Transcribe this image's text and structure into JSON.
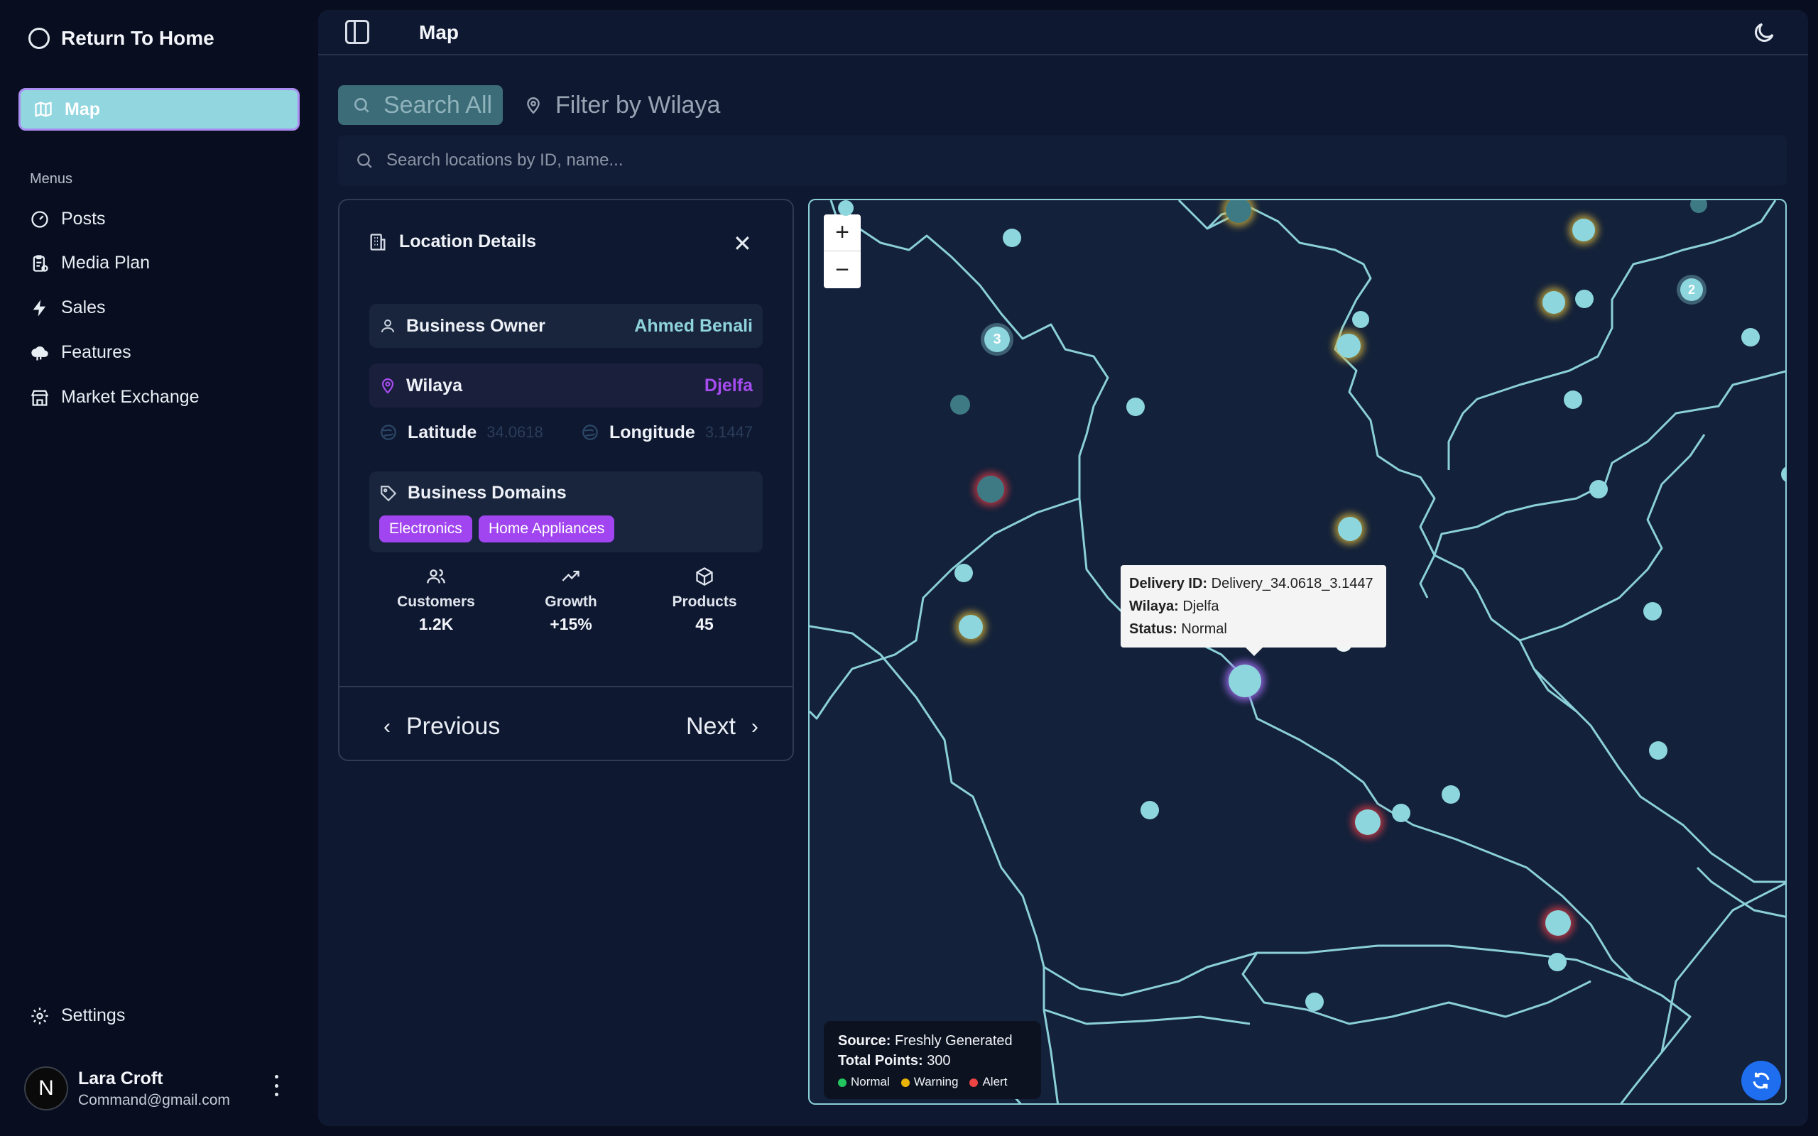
{
  "sidebar": {
    "brand": "Return To Home",
    "active_item": "Map",
    "section_label": "Menus",
    "items": [
      {
        "label": "Posts",
        "icon": "gauge-icon"
      },
      {
        "label": "Media Plan",
        "icon": "clipboard-icon"
      },
      {
        "label": "Sales",
        "icon": "lightning-icon"
      },
      {
        "label": "Features",
        "icon": "cloud-icon"
      },
      {
        "label": "Market Exchange",
        "icon": "store-icon"
      }
    ],
    "settings": "Settings",
    "user": {
      "initial": "N",
      "name": "Lara Croft",
      "email": "Command@gmail.com"
    }
  },
  "header": {
    "title": "Map"
  },
  "tabs": {
    "search_all": "Search All",
    "filter_wilaya": "Filter by Wilaya"
  },
  "search": {
    "placeholder": "Search locations by ID, name..."
  },
  "details": {
    "title": "Location Details",
    "owner_label": "Business Owner",
    "owner_value": "Ahmed Benali",
    "wilaya_label": "Wilaya",
    "wilaya_value": "Djelfa",
    "latitude_label": "Latitude",
    "latitude_value": "34.0618",
    "longitude_label": "Longitude",
    "longitude_value": "3.1447",
    "domains_label": "Business Domains",
    "domains": [
      "Electronics",
      "Home Appliances"
    ],
    "stats": [
      {
        "label": "Customers",
        "value": "1.2K"
      },
      {
        "label": "Growth",
        "value": "+15%"
      },
      {
        "label": "Products",
        "value": "45"
      }
    ],
    "prev": "Previous",
    "next": "Next"
  },
  "map": {
    "zoom_in": "+",
    "zoom_out": "−",
    "clusters": [
      "3",
      "2"
    ],
    "tooltip": {
      "id_label": "Delivery ID:",
      "id_value": "Delivery_34.0618_3.1447",
      "wilaya_label": "Wilaya:",
      "wilaya_value": "Djelfa",
      "status_label": "Status:",
      "status_value": "Normal"
    },
    "legend": {
      "source_label": "Source:",
      "source_value": "Freshly Generated",
      "total_label": "Total Points:",
      "total_value": "300",
      "normal": "Normal",
      "warning": "Warning",
      "alert": "Alert"
    }
  },
  "colors": {
    "accent": "#92d6df",
    "owner_value": "#8fd3dc",
    "wilaya_value": "#a64cf0",
    "tag": "#a045f0",
    "normal": "#22c55e",
    "warning": "#eab308",
    "alert": "#ef4444"
  }
}
